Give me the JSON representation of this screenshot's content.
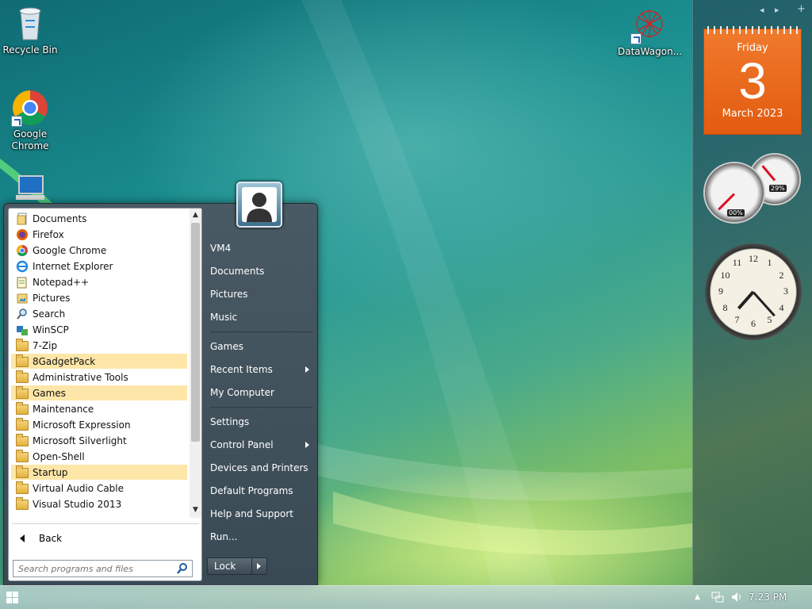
{
  "desktop": {
    "icons": [
      {
        "label": "Recycle Bin",
        "icon": "recycle-bin-icon"
      },
      {
        "label": "Google Chrome",
        "icon": "chrome-icon"
      },
      {
        "label": "DataWagon...",
        "icon": "datawagon-icon"
      }
    ]
  },
  "sidebar": {
    "controls": [
      "◂",
      "▸",
      "+"
    ],
    "calendar": {
      "weekday": "Friday",
      "day": "3",
      "month_year": "March 2023"
    },
    "cpu_meter": {
      "cpu_percent_label": "00%",
      "memory_percent_label": "29%",
      "cpu_value": 0,
      "memory_value": 29
    },
    "clock": {
      "numbers": [
        "12",
        "1",
        "2",
        "3",
        "4",
        "5",
        "6",
        "7",
        "8",
        "9",
        "10",
        "11"
      ],
      "hour": 7,
      "minute": 23
    }
  },
  "start_menu": {
    "programs": [
      {
        "label": "Documents",
        "icon": "documents-icon",
        "highlight": false
      },
      {
        "label": "Firefox",
        "icon": "firefox-icon",
        "highlight": false
      },
      {
        "label": "Google Chrome",
        "icon": "chrome-icon",
        "highlight": false
      },
      {
        "label": "Internet Explorer",
        "icon": "internet-explorer-icon",
        "highlight": false
      },
      {
        "label": "Notepad++",
        "icon": "notepad-plus-plus-icon",
        "highlight": false
      },
      {
        "label": "Pictures",
        "icon": "pictures-icon",
        "highlight": false
      },
      {
        "label": "Search",
        "icon": "search-icon",
        "highlight": false
      },
      {
        "label": "WinSCP",
        "icon": "winscp-icon",
        "highlight": false
      },
      {
        "label": "7-Zip",
        "icon": "folder-icon",
        "highlight": false
      },
      {
        "label": "8GadgetPack",
        "icon": "folder-icon",
        "highlight": true
      },
      {
        "label": "Administrative Tools",
        "icon": "folder-icon",
        "highlight": false
      },
      {
        "label": "Games",
        "icon": "folder-icon",
        "highlight": true
      },
      {
        "label": "Maintenance",
        "icon": "folder-icon",
        "highlight": false
      },
      {
        "label": "Microsoft Expression",
        "icon": "folder-icon",
        "highlight": false
      },
      {
        "label": "Microsoft Silverlight",
        "icon": "folder-icon",
        "highlight": false
      },
      {
        "label": "Open-Shell",
        "icon": "folder-icon",
        "highlight": false
      },
      {
        "label": "Startup",
        "icon": "folder-icon",
        "highlight": true
      },
      {
        "label": "Virtual Audio Cable",
        "icon": "folder-icon",
        "highlight": false
      },
      {
        "label": "Visual Studio 2013",
        "icon": "folder-icon",
        "highlight": false
      }
    ],
    "back_label": "Back",
    "search_placeholder": "Search programs and files",
    "right_items": [
      {
        "label": "VM4",
        "submenu": false
      },
      {
        "label": "Documents",
        "submenu": false
      },
      {
        "label": "Pictures",
        "submenu": false
      },
      {
        "label": "Music",
        "submenu": false
      },
      {
        "label": "Games",
        "submenu": false
      },
      {
        "label": "Recent Items",
        "submenu": true
      },
      {
        "label": "My Computer",
        "submenu": false
      },
      {
        "label": "Settings",
        "submenu": false
      },
      {
        "label": "Control Panel",
        "submenu": true
      },
      {
        "label": "Devices and Printers",
        "submenu": false
      },
      {
        "label": "Default Programs",
        "submenu": false
      },
      {
        "label": "Help and Support",
        "submenu": false
      },
      {
        "label": "Run...",
        "submenu": false
      }
    ],
    "lock_label": "Lock"
  },
  "taskbar": {
    "time": "7:23 PM",
    "tray_icons": [
      "show-hidden-icons-icon",
      "network-icon",
      "volume-icon"
    ]
  }
}
